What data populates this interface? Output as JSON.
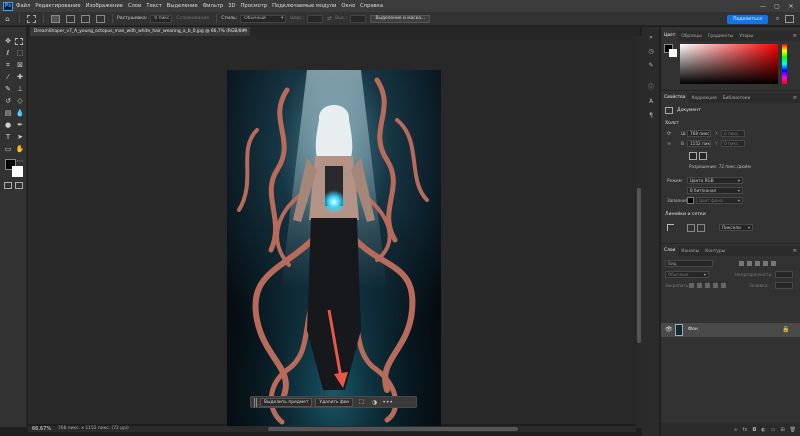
{
  "menu": {
    "app_icon": "Ps",
    "items": [
      "Файл",
      "Редактирование",
      "Изображение",
      "Слои",
      "Текст",
      "Выделение",
      "Фильтр",
      "3D",
      "Просмотр",
      "Подключаемые модули",
      "Окно",
      "Справка"
    ],
    "window_controls": [
      "—",
      "▢",
      "✕"
    ]
  },
  "options_bar": {
    "feather_label": "Растушевка:",
    "feather_value": "0 пикс.",
    "antialias_label": "Сглаживание",
    "style_label": "Стиль:",
    "style_value": "Обычный",
    "width_label": "Шир.:",
    "height_label": "Выс.:",
    "select_mask_button": "Выделение и маска...",
    "share_button": "Поделиться"
  },
  "document": {
    "tab_title": "DreamShaper_v7_A_young_octopus_man_with_white_hair_wearing_a_b_0.jpg @ 66,7% (RGB/8#)",
    "close_glyph": "✕"
  },
  "context_bar": {
    "select_subject_button": "Выделить предмет",
    "remove_bg_button": "Удалить фон",
    "more_glyph": "•••"
  },
  "status": {
    "zoom": "66,67%",
    "doc_info": "768 пикс. x 1152 пикс. (72 ppi)"
  },
  "color_panel": {
    "tabs": [
      "Цвет",
      "Образцы",
      "Градиенты",
      "Узоры"
    ]
  },
  "properties_panel": {
    "tabs": [
      "Свойства",
      "Коррекция",
      "Библиотеки"
    ],
    "doc_label": "Документ",
    "canvas_section": "Холст",
    "width_prefix": "Ш",
    "width_value": "768 пикс.",
    "x_label": "X",
    "x_value": "0 пикс.",
    "height_prefix": "В",
    "height_value": "1152 пикс.",
    "y_label": "Y",
    "y_value": "0 пикс.",
    "resolution": "Разрешение: 72 пикс./дюйм",
    "mode_label": "Режим",
    "mode_value": "Цвета RGB",
    "depth_value": "8 бит/канал",
    "fill_label": "Заполнить",
    "fill_value": "Цвет фона",
    "rulers_section": "Линейки и сетки",
    "units_value": "Пиксели"
  },
  "layers_panel": {
    "tabs": [
      "Слои",
      "Каналы",
      "Контуры"
    ],
    "search_placeholder": "Вид",
    "blend_mode": "Обычные",
    "opacity_label": "Непрозрачность:",
    "lock_label": "Закрепить:",
    "fill_label": "Заливка:",
    "layer_name": "Фон"
  }
}
